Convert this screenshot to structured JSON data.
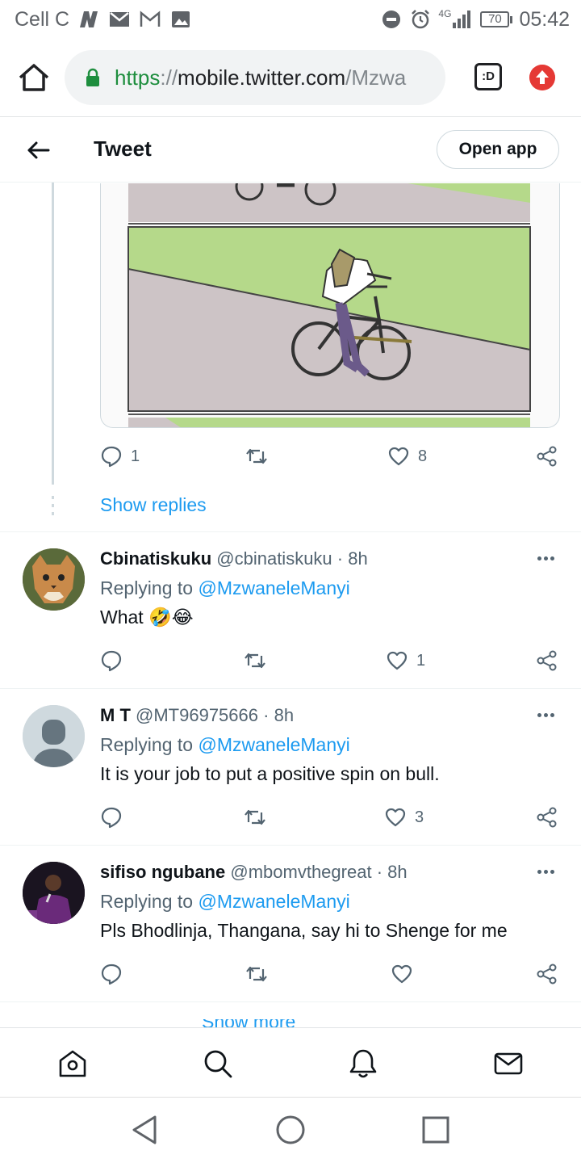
{
  "status_bar": {
    "carrier": "Cell C",
    "network": "4G",
    "battery": "70",
    "time": "05:42"
  },
  "browser": {
    "url_scheme": "https",
    "url_sep": "://",
    "url_host": "mobile.twitter.com",
    "url_path": "/Mzwa",
    "tabs_label": ":D"
  },
  "header": {
    "title": "Tweet",
    "open_app": "Open app"
  },
  "main_tweet": {
    "reply_count": "1",
    "like_count": "8",
    "show_replies": "Show replies"
  },
  "replies": [
    {
      "name": "Cbinatiskuku",
      "handle": "@cbinatiskuku",
      "time": "8h",
      "replying_prefix": "Replying to",
      "mention": "@MzwaneleManyi",
      "text": "What 🤣😂",
      "like_count": "1"
    },
    {
      "name": "M T",
      "handle": "@MT96975666",
      "time": "8h",
      "replying_prefix": "Replying to",
      "mention": "@MzwaneleManyi",
      "text": "It is your job to put a positive spin on bull.",
      "like_count": "3"
    },
    {
      "name": "sifiso ngubane",
      "handle": "@mbomvthegreat",
      "time": "8h",
      "replying_prefix": "Replying to",
      "mention": "@MzwaneleManyi",
      "text": "Pls Bhodlinja, Thangana, say hi to Shenge for me",
      "like_count": ""
    }
  ],
  "partial_link": "Show more replies",
  "colors": {
    "accent": "#1d9bf0",
    "text": "#0f1419",
    "muted": "#536471",
    "panel_green": "#b5d98a",
    "panel_gray": "#cdc4c6"
  }
}
